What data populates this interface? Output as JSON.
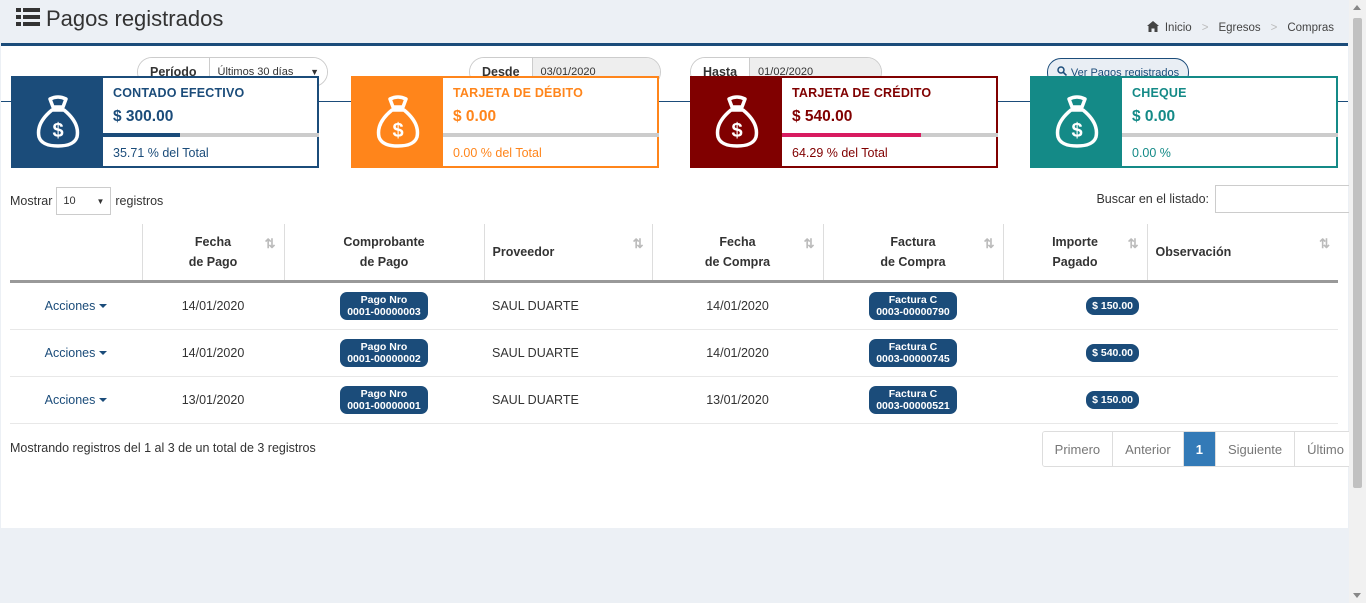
{
  "page": {
    "title": "Pagos registrados",
    "title_icon": "list-icon"
  },
  "breadcrumb": {
    "items": [
      "Inicio",
      "Egresos",
      "Compras"
    ],
    "home_icon": "home-icon"
  },
  "filters": {
    "periodo": {
      "label": "Período",
      "value": "Últimos 30 días"
    },
    "desde": {
      "label": "Desde",
      "value": "03/01/2020"
    },
    "hasta": {
      "label": "Hasta",
      "value": "01/02/2020"
    },
    "button": "Ver Pagos registrados"
  },
  "cards": [
    {
      "name": "CONTADO EFECTIVO",
      "amount": "$ 300.00",
      "pct_text": "35.71 % del Total",
      "pct": 35.71,
      "color": "#1b4c7a",
      "icon": "money-bag-icon"
    },
    {
      "name": "TARJETA DE DÉBITO",
      "amount": "$ 0.00",
      "pct_text": "0.00 % del Total",
      "pct": 0,
      "color": "#ff851b",
      "icon": "money-bag-icon"
    },
    {
      "name": "TARJETA DE CRÉDITO",
      "amount": "$ 540.00",
      "pct_text": "64.29 % del Total",
      "pct": 64.29,
      "color": "#800000",
      "bar_color": "#d81b60",
      "icon": "money-bag-icon"
    },
    {
      "name": "CHEQUE",
      "amount": "$ 0.00",
      "pct_text": "0.00 %",
      "pct": 0,
      "color": "#148a87",
      "icon": "money-bag-icon"
    }
  ],
  "table_controls": {
    "show_label": "Mostrar",
    "page_length": "10",
    "records_label": "registros",
    "search_label": "Buscar en el listado:"
  },
  "table": {
    "headers": [
      {
        "line1": "",
        "line2": ""
      },
      {
        "line1": "Fecha",
        "line2": "de Pago"
      },
      {
        "line1": "Comprobante",
        "line2": "de Pago"
      },
      {
        "line1": "Proveedor",
        "line2": ""
      },
      {
        "line1": "Fecha",
        "line2": "de Compra"
      },
      {
        "line1": "Factura",
        "line2": "de Compra"
      },
      {
        "line1": "Importe",
        "line2": "Pagado"
      },
      {
        "line1": "Observación",
        "line2": ""
      }
    ],
    "rows": [
      {
        "acciones": "Acciones",
        "fecha_pago": "14/01/2020",
        "comp_l1": "Pago Nro",
        "comp_l2": "0001-00000003",
        "proveedor": "SAUL DUARTE",
        "fecha_compra": "14/01/2020",
        "fact_l1": "Factura C",
        "fact_l2": "0003-00000790",
        "importe": "$ 150.00",
        "obs": ""
      },
      {
        "acciones": "Acciones",
        "fecha_pago": "14/01/2020",
        "comp_l1": "Pago Nro",
        "comp_l2": "0001-00000002",
        "proveedor": "SAUL DUARTE",
        "fecha_compra": "14/01/2020",
        "fact_l1": "Factura C",
        "fact_l2": "0003-00000745",
        "importe": "$ 540.00",
        "obs": ""
      },
      {
        "acciones": "Acciones",
        "fecha_pago": "13/01/2020",
        "comp_l1": "Pago Nro",
        "comp_l2": "0001-00000001",
        "proveedor": "SAUL DUARTE",
        "fecha_compra": "13/01/2020",
        "fact_l1": "Factura C",
        "fact_l2": "0003-00000521",
        "importe": "$ 150.00",
        "obs": ""
      }
    ]
  },
  "footer": {
    "info": "Mostrando registros del 1 al 3 de un total de 3 registros"
  },
  "pagination": {
    "first": "Primero",
    "prev": "Anterior",
    "current": "1",
    "next": "Siguiente",
    "last": "Último"
  }
}
